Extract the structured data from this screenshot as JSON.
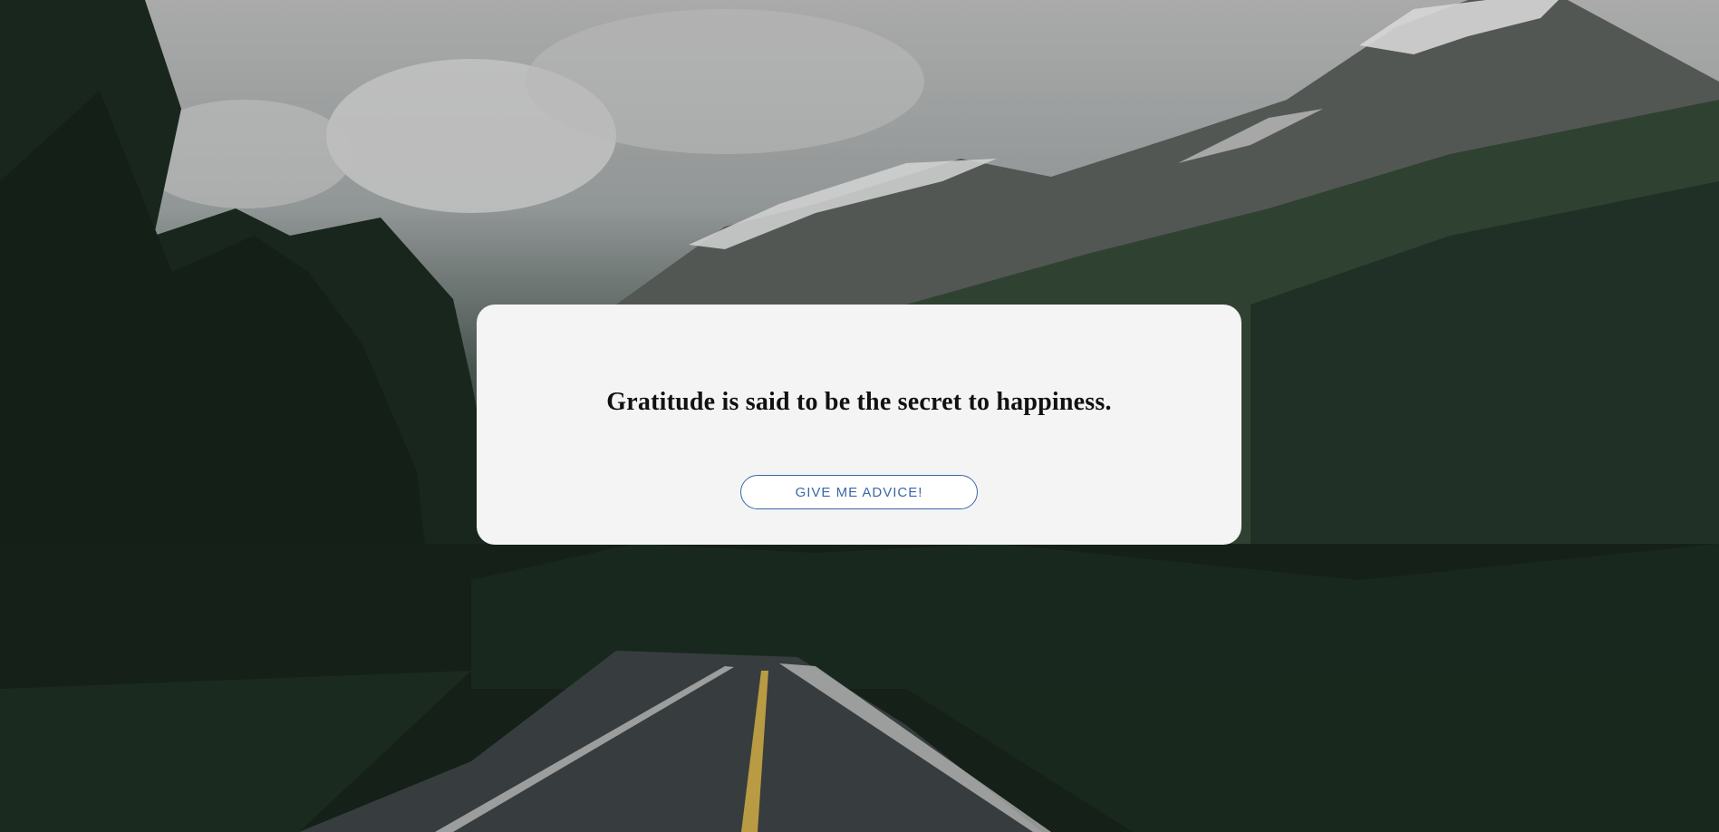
{
  "advice": {
    "quote": "Gratitude is said to be the secret to happiness.",
    "button_label": "GIVE ME ADVICE!"
  },
  "background": {
    "scene": "mountain-road-forest-photo",
    "sky_color": "#b9b9b9",
    "forest_color": "#1a2a20"
  },
  "colors": {
    "card_bg": "#f4f4f4",
    "button_accent": "#3b67a8",
    "quote_text": "#111111"
  }
}
